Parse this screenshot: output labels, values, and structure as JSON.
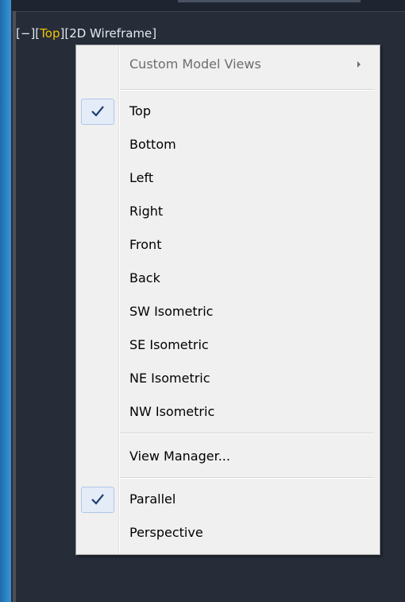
{
  "viewport": {
    "label": {
      "open": "[",
      "minus": "−",
      "close_open": "][",
      "view": "Top",
      "close_open2": "][",
      "style": "2D Wireframe",
      "end": "]"
    },
    "accent_color": "#f2c200"
  },
  "menu": {
    "custom_views": "Custom Model Views",
    "views": [
      "Top",
      "Bottom",
      "Left",
      "Right",
      "Front",
      "Back",
      "SW Isometric",
      "SE Isometric",
      "NE Isometric",
      "NW Isometric"
    ],
    "checked_view": "Top",
    "view_manager": "View Manager...",
    "projection": [
      "Parallel",
      "Perspective"
    ],
    "checked_projection": "Parallel"
  }
}
